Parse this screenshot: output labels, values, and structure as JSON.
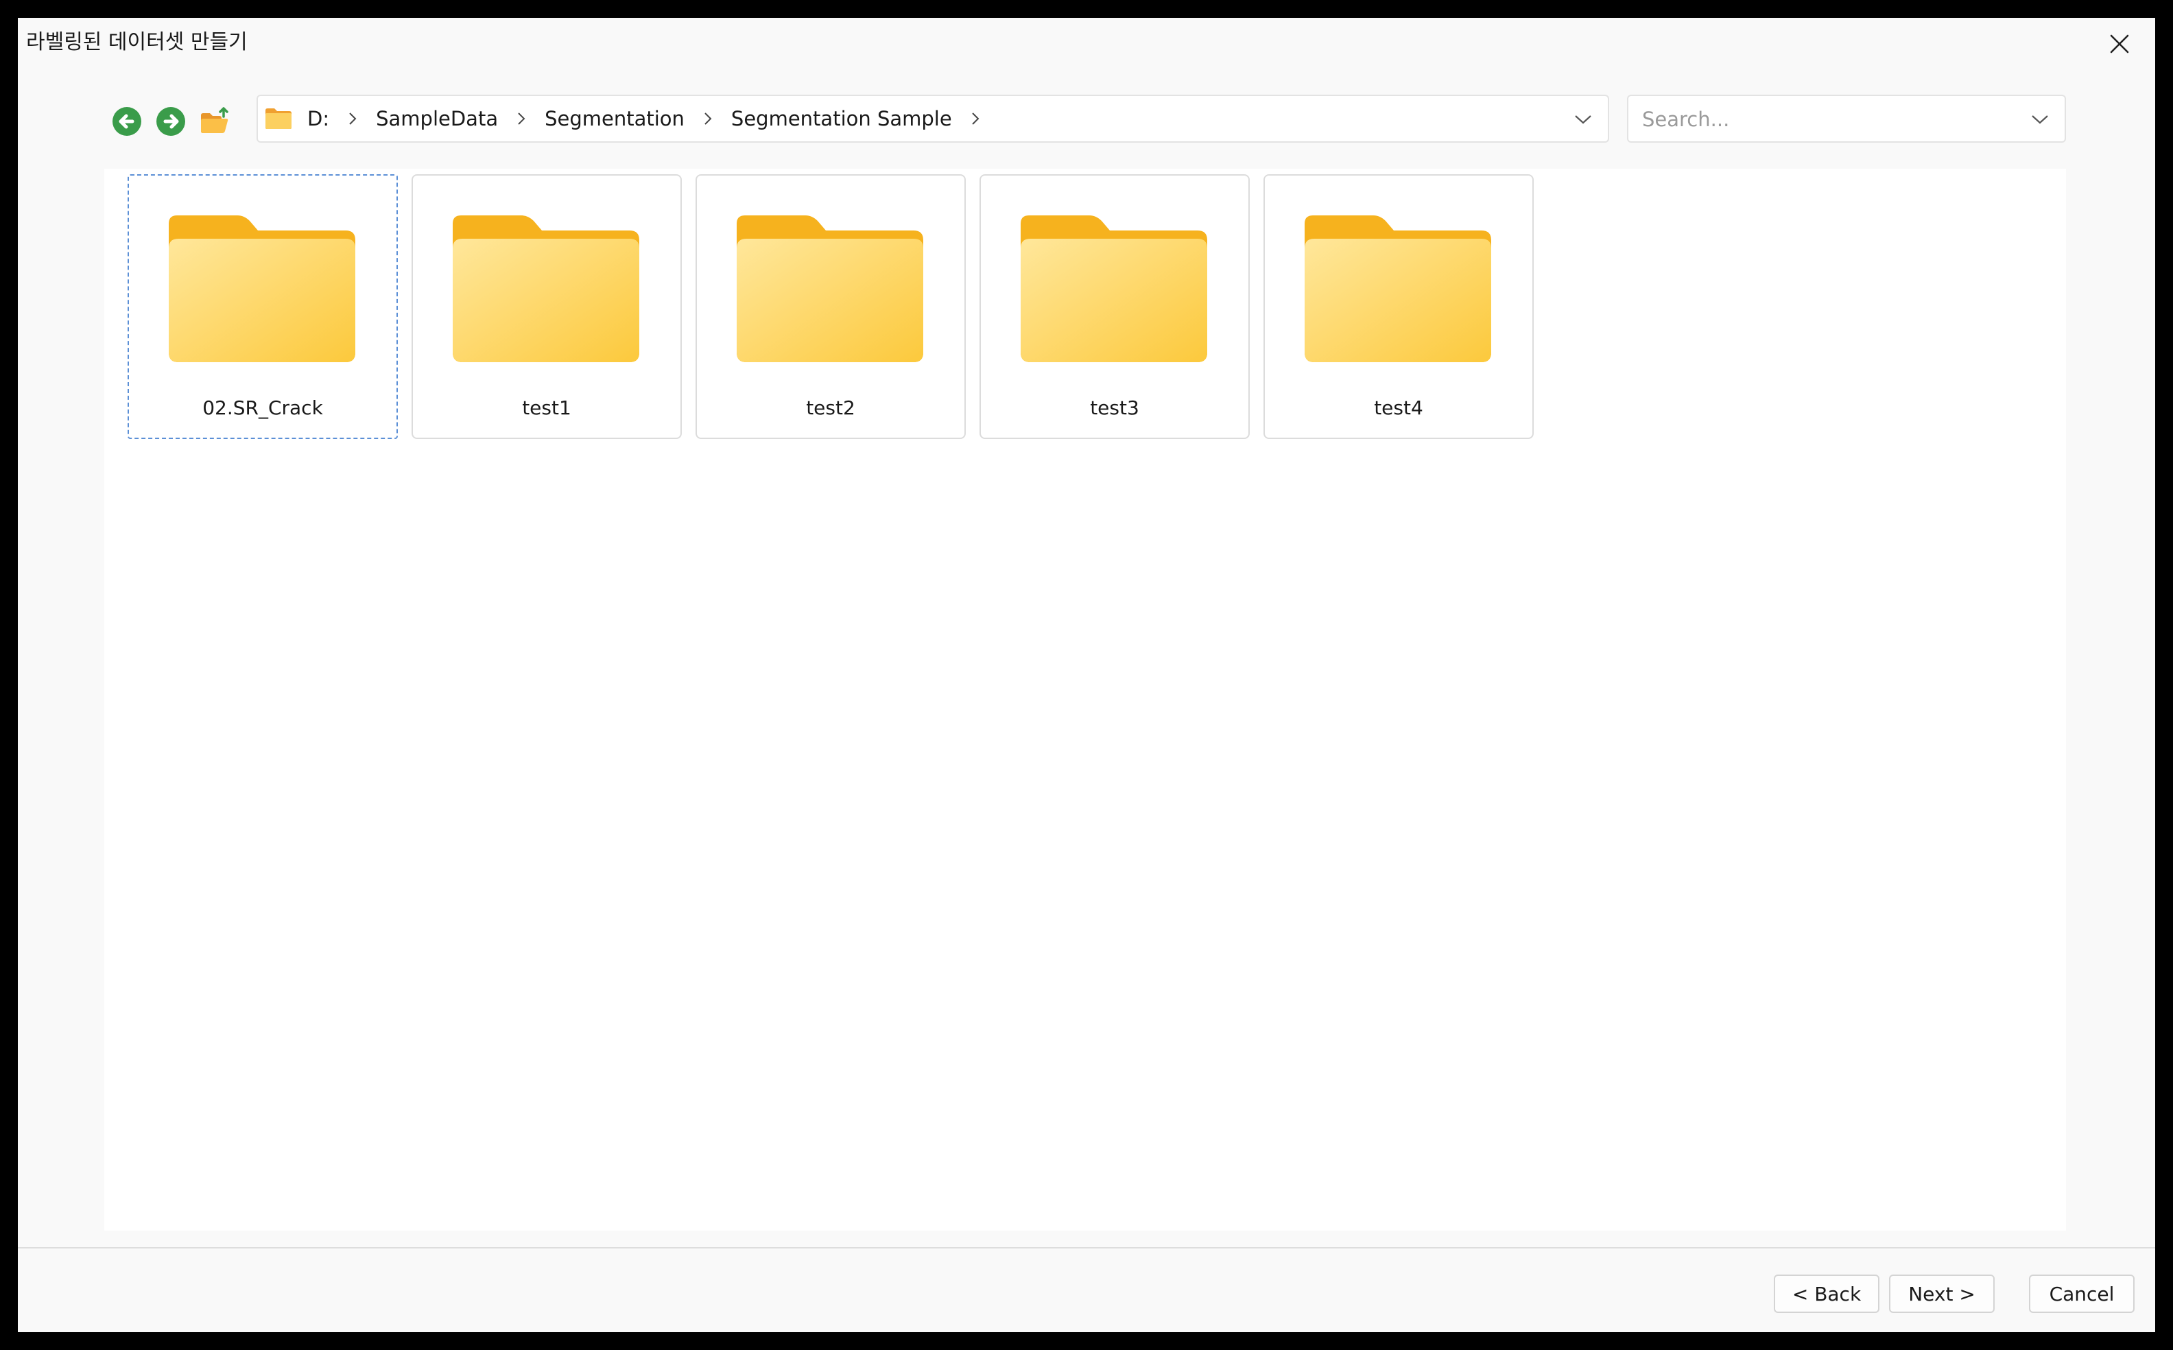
{
  "window": {
    "title": "라벨링된 데이터셋 만들기"
  },
  "toolbar": {
    "back_icon": "arrow-left-circle-icon",
    "forward_icon": "arrow-right-circle-icon",
    "up_icon": "folder-up-icon"
  },
  "address": {
    "crumbs": [
      "D:",
      "SampleData",
      "Segmentation",
      "Segmentation Sample"
    ]
  },
  "search": {
    "placeholder": "Search...",
    "value": ""
  },
  "folders": [
    {
      "name": "02.SR_Crack",
      "selected": true
    },
    {
      "name": "test1",
      "selected": false
    },
    {
      "name": "test2",
      "selected": false
    },
    {
      "name": "test3",
      "selected": false
    },
    {
      "name": "test4",
      "selected": false
    }
  ],
  "buttons": {
    "back": "< Back",
    "next": "Next >",
    "cancel": "Cancel"
  },
  "colors": {
    "nav_green": "#3a9c4a",
    "folder_yellow": "#fcc93c",
    "folder_orange": "#f0a030",
    "selection_blue": "#5b8fd6"
  }
}
